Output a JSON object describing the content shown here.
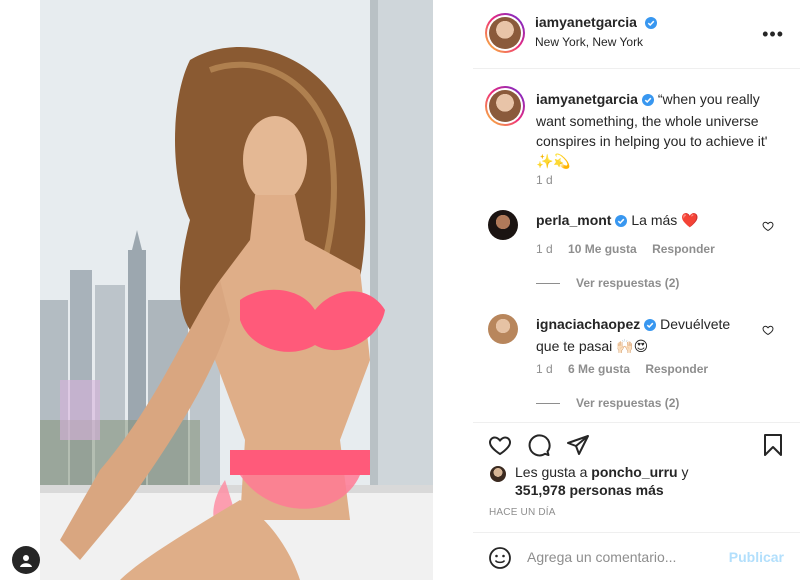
{
  "post": {
    "username": "iamyanetgarcia",
    "location": "New York, New York",
    "more": "•••"
  },
  "caption": {
    "username": "iamyanetgarcia",
    "text": "“when you really want something, the whole universe conspires in helping you to achieve it'",
    "emoji": "✨💫",
    "time": "1 d"
  },
  "comments": [
    {
      "username": "perla_mont",
      "text": "La más ❤️",
      "time": "1 d",
      "likes": "10 Me gusta",
      "reply": "Responder",
      "view_replies": "Ver respuestas (2)"
    },
    {
      "username": "ignaciachaopez",
      "text": "Devuélvete que te pasai 🙌🏻😍",
      "time": "1 d",
      "likes": "6 Me gusta",
      "reply": "Responder",
      "view_replies": "Ver respuestas (2)"
    }
  ],
  "likes": {
    "prefix": "Les gusta a",
    "user": "poncho_urru",
    "conj": "y",
    "count": "351,978 personas más"
  },
  "time_ago": "HACE UN DÍA",
  "add_comment": {
    "placeholder": "Agrega un comentario...",
    "post_label": "Publicar"
  },
  "colors": {
    "verified": "#3897f0",
    "link": "#b2dffc",
    "muted": "#8e8e8e",
    "heart": "#ed4956"
  },
  "icons": [
    "heart-icon",
    "comment-icon",
    "share-icon",
    "bookmark-icon",
    "emoji-icon",
    "verified-badge-icon",
    "more-icon"
  ]
}
